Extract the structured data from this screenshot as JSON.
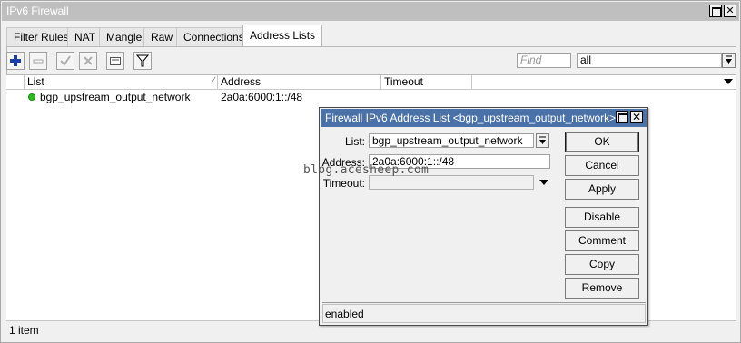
{
  "window": {
    "title": "IPv6 Firewall",
    "maximize_glyph": "",
    "close_glyph": "✕"
  },
  "tabs": [
    {
      "label": "Filter Rules"
    },
    {
      "label": "NAT"
    },
    {
      "label": "Mangle"
    },
    {
      "label": "Raw"
    },
    {
      "label": "Connections"
    },
    {
      "label": "Address Lists",
      "active": true
    }
  ],
  "toolbar": {
    "icons": [
      "add-icon",
      "remove-icon",
      "enable-icon",
      "disable-icon",
      "comment-icon",
      "filter-icon"
    ],
    "find_placeholder": "Find",
    "filter_value": "all"
  },
  "table": {
    "columns": [
      "List",
      "Address",
      "Timeout"
    ],
    "rows": [
      {
        "list": "bgp_upstream_output_network",
        "address": "2a0a:6000:1::/48",
        "timeout": "",
        "status_color": "#2dbb1f"
      }
    ]
  },
  "status": {
    "items": "1 item"
  },
  "dialog": {
    "title": "Firewall IPv6 Address List <bgp_upstream_output_network>",
    "close_glyph": "✕",
    "fields": {
      "list_label": "List:",
      "list_value": "bgp_upstream_output_network",
      "address_label": "Address:",
      "address_value": "2a0a:6000:1::/48",
      "timeout_label": "Timeout:",
      "timeout_value": ""
    },
    "buttons": {
      "ok": "OK",
      "cancel": "Cancel",
      "apply": "Apply",
      "disable": "Disable",
      "comment": "Comment",
      "copy": "Copy",
      "remove": "Remove"
    },
    "status": "enabled"
  },
  "watermark": "blog.acesheep.com"
}
